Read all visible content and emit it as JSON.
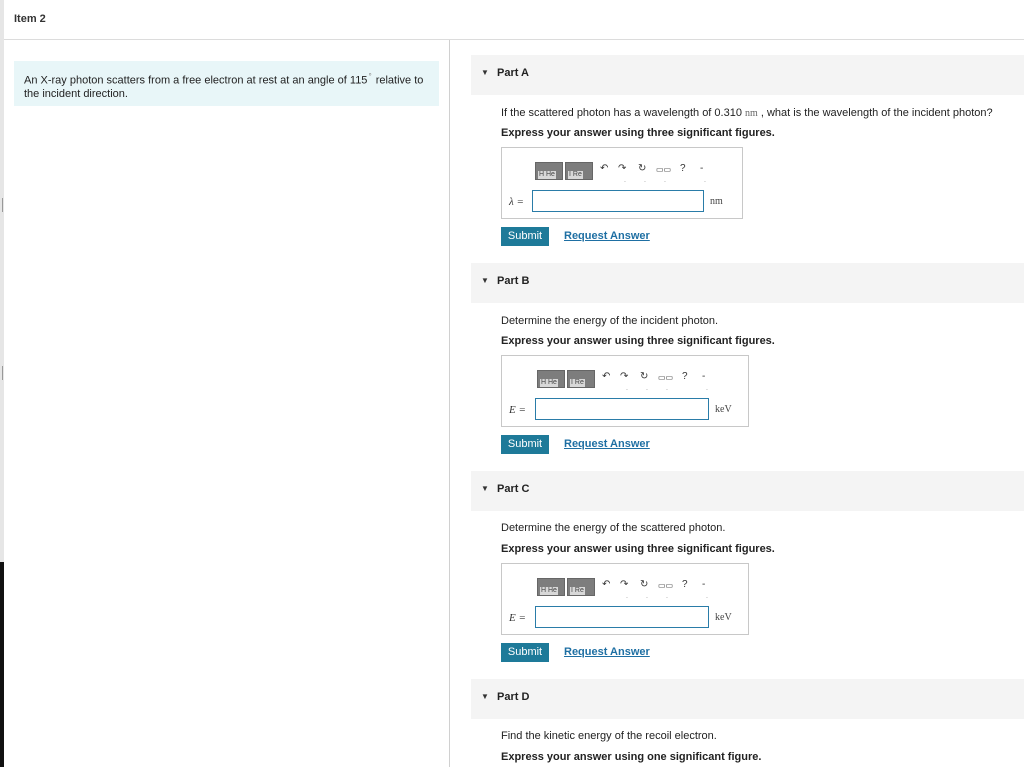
{
  "item": {
    "title": "Item 2"
  },
  "problem": {
    "text_before": "An X-ray photon scatters from a free electron at rest at an angle of 115",
    "degree_mark": "°",
    "text_after": " relative to the incident direction."
  },
  "toolbar": {
    "block1_label": "H  He",
    "block2_label": "I  Re",
    "undo": "↶",
    "redo": "↷",
    "reset": "↻",
    "keyboard": "▭▭",
    "help": "?",
    "dash": "-"
  },
  "controls": {
    "submit_label": "Submit",
    "request_label": "Request Answer"
  },
  "parts": [
    {
      "title": "Part A",
      "question_before": "If the scattered photon has a wavelength of 0.310",
      "question_unit": "nm",
      "question_after": " , what is the wavelength of the incident photon?",
      "instruction": "Express your answer using three significant figures.",
      "var_label": "λ =",
      "unit": "nm",
      "value": ""
    },
    {
      "title": "Part B",
      "question": "Determine the energy of the incident photon.",
      "instruction": "Express your answer using three significant figures.",
      "var_label": "E =",
      "unit": "keV",
      "value": ""
    },
    {
      "title": "Part C",
      "question": "Determine the energy of the scattered photon.",
      "instruction": "Express your answer using three significant figures.",
      "var_label": "E =",
      "unit": "keV",
      "value": ""
    },
    {
      "title": "Part D",
      "question": "Find the kinetic energy of the recoil electron.",
      "instruction": "Express your answer using one significant figure."
    }
  ]
}
